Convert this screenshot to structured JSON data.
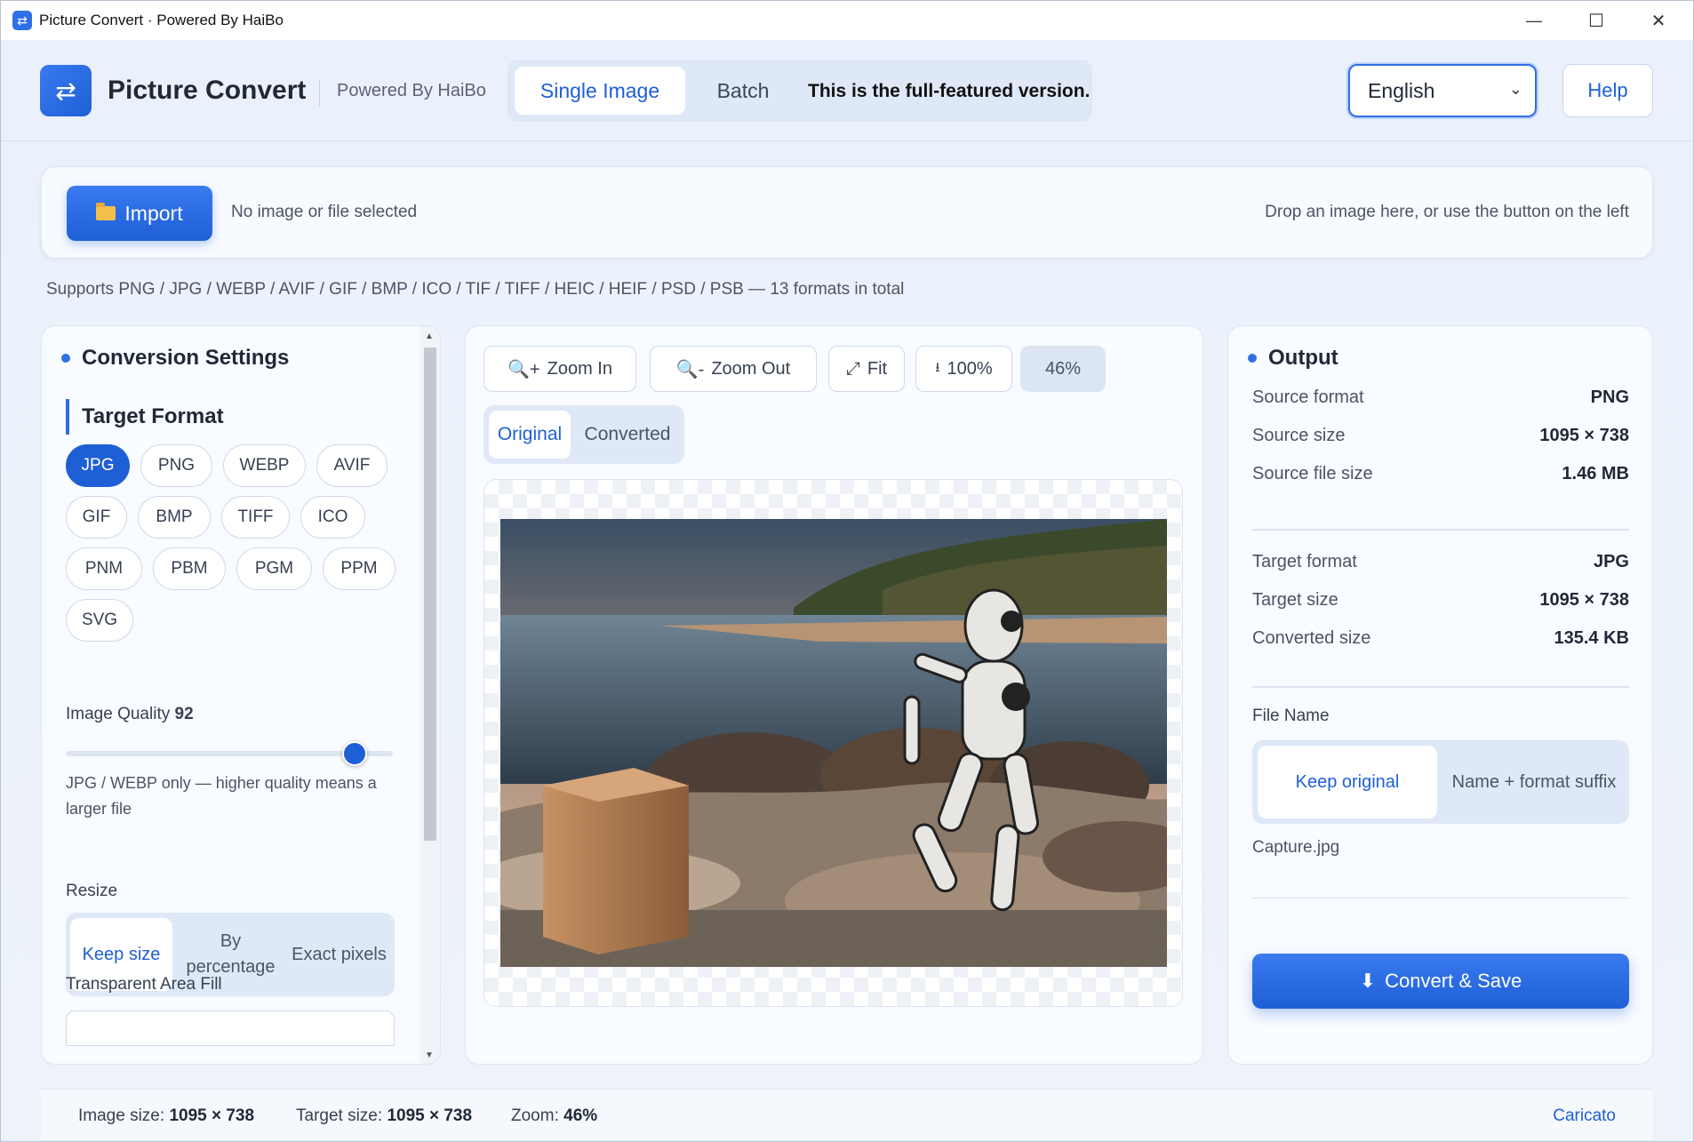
{
  "window": {
    "title": "Picture Convert · Powered By HaiBo",
    "minimize": "—",
    "maximize": "☐",
    "close": "✕"
  },
  "header": {
    "app_name": "Picture Convert",
    "powered": "Powered By HaiBo",
    "tabs": [
      {
        "label": "Single Image",
        "active": true
      },
      {
        "label": "Batch",
        "active": false
      }
    ],
    "version_note": "This is the full-featured version.",
    "language": "English",
    "help": "Help"
  },
  "import": {
    "button": "Import",
    "status": "No image or file selected",
    "drop_hint": "Drop an image here, or use the button on the left"
  },
  "supports": "Supports PNG / JPG / WEBP / AVIF / GIF / BMP / ICO / TIF / TIFF / HEIC / HEIF / PSD / PSB — 13 formats in total",
  "settings": {
    "title": "Conversion Settings",
    "target_format_title": "Target Format",
    "formats": [
      "JPG",
      "PNG",
      "WEBP",
      "AVIF",
      "GIF",
      "BMP",
      "TIFF",
      "ICO",
      "PNM",
      "PBM",
      "PGM",
      "PPM",
      "SVG"
    ],
    "selected_format": "JPG",
    "quality_label": "Image Quality",
    "quality_value": "92",
    "quality_fraction": 0.92,
    "quality_hint": "JPG / WEBP only — higher quality means a larger file",
    "resize_label": "Resize",
    "resize_options": [
      "Keep size",
      "By percentage",
      "Exact pixels"
    ],
    "resize_selected": "Keep size",
    "fill_label": "Transparent Area Fill"
  },
  "preview": {
    "zoom_in": "Zoom In",
    "zoom_out": "Zoom Out",
    "fit": "Fit",
    "actual": "100%",
    "zoom": "46%",
    "view_tabs": [
      "Original",
      "Converted"
    ],
    "view_selected": "Original"
  },
  "output": {
    "title": "Output",
    "source_format_k": "Source format",
    "source_format_v": "PNG",
    "source_size_k": "Source size",
    "source_size_v": "1095 × 738",
    "source_file_size_k": "Source file size",
    "source_file_size_v": "1.46 MB",
    "target_format_k": "Target format",
    "target_format_v": "JPG",
    "target_size_k": "Target size",
    "target_size_v": "1095 × 738",
    "converted_size_k": "Converted size",
    "converted_size_v": "135.4 KB",
    "file_name_label": "File Name",
    "name_options": [
      "Keep original",
      "Name + format suffix"
    ],
    "name_selected": "Keep original",
    "file_name": "Capture.jpg",
    "convert_button": "Convert & Save"
  },
  "status": {
    "image_size_label": "Image size:",
    "image_size": "1095 × 738",
    "target_size_label": "Target size:",
    "target_size": "1095 × 738",
    "zoom_label": "Zoom:",
    "zoom": "46%",
    "loaded": "Caricato"
  },
  "colors": {
    "accent": "#1f5fd6",
    "panel_bg": "#f8fbff",
    "app_bg": "#eaf1fc"
  }
}
